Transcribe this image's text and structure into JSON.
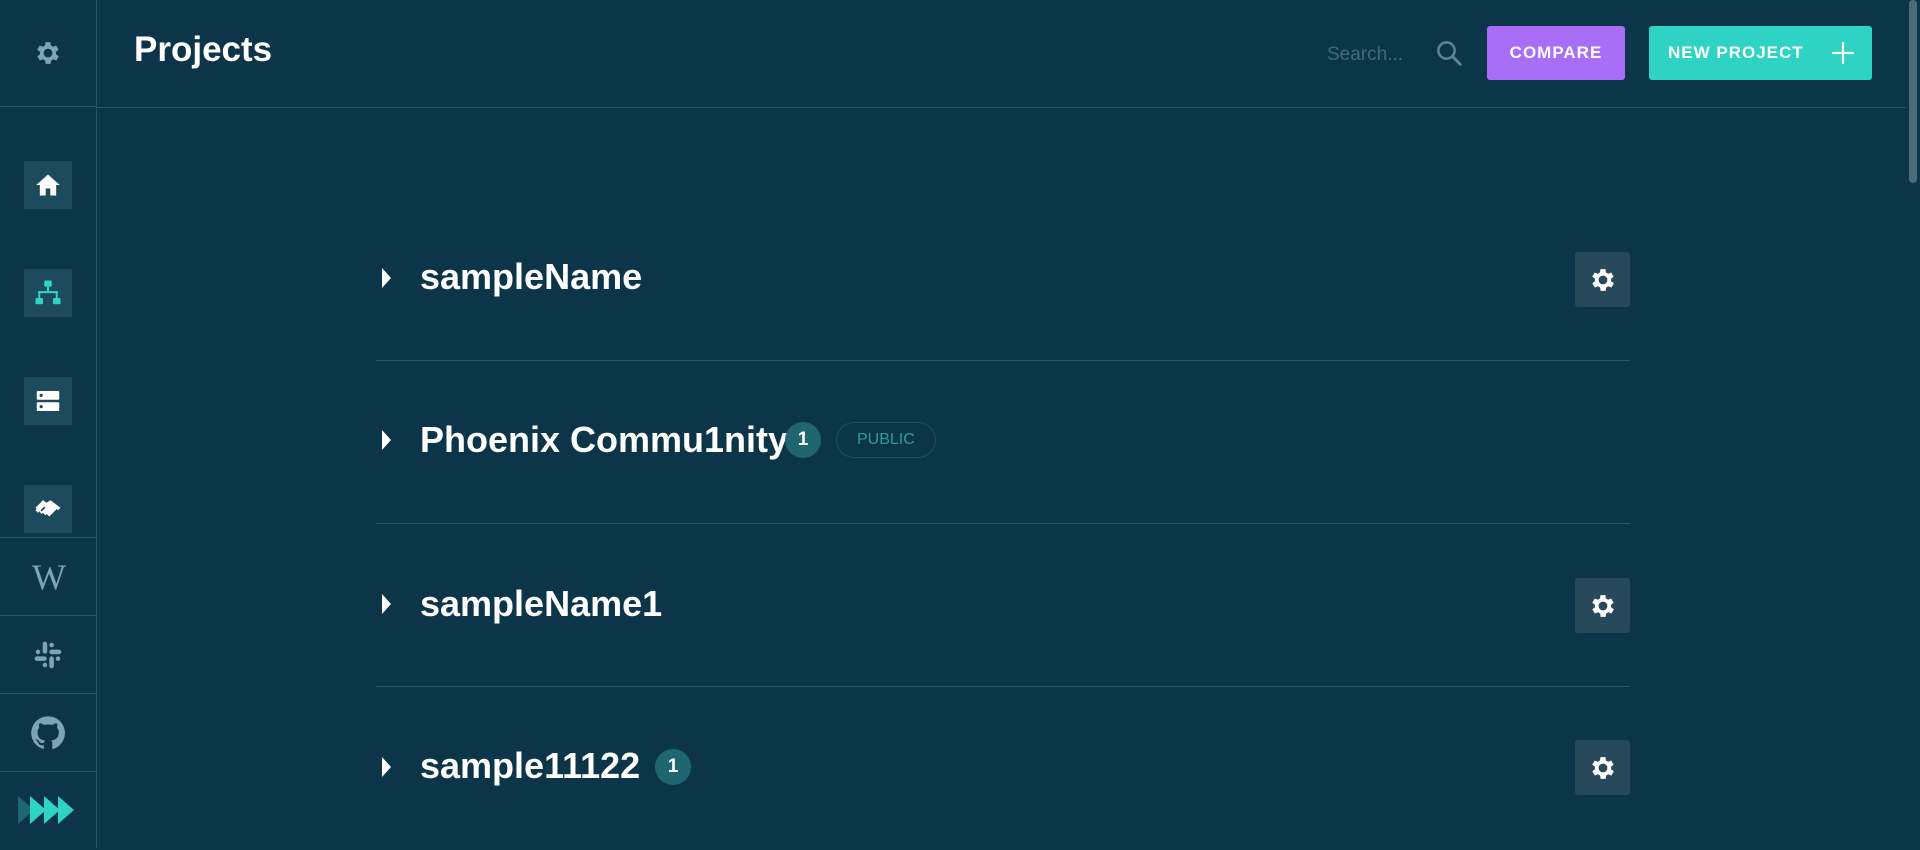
{
  "header": {
    "title": "Projects",
    "search_placeholder": "Search...",
    "compare_label": "COMPARE",
    "new_project_label": "NEW PROJECT"
  },
  "sidebar": {
    "nav_items": [
      {
        "name": "home",
        "icon": "home-icon"
      },
      {
        "name": "projects",
        "icon": "sitemap-icon"
      },
      {
        "name": "servers",
        "icon": "server-icon"
      },
      {
        "name": "partners",
        "icon": "handshake-icon"
      }
    ],
    "links": [
      {
        "name": "wiki",
        "icon": "wikipedia-icon",
        "glyph": "W"
      },
      {
        "name": "slack",
        "icon": "slack-icon"
      },
      {
        "name": "github",
        "icon": "github-icon"
      },
      {
        "name": "expand",
        "icon": "triple-chevron-icon"
      }
    ]
  },
  "projects": [
    {
      "name": "sampleName",
      "count": null,
      "visibility": null,
      "has_settings": true
    },
    {
      "name": "Phoenix Commu1nity",
      "count": "1",
      "visibility": "PUBLIC",
      "has_settings": false
    },
    {
      "name": "sampleName1",
      "count": null,
      "visibility": null,
      "has_settings": true
    },
    {
      "name": "sample11122",
      "count": "1",
      "visibility": null,
      "has_settings": true
    }
  ],
  "colors": {
    "background": "#0d3549",
    "compare": "#a96ef8",
    "new_project": "#2fd3c4",
    "accent_teal": "#2fd3c4",
    "count_badge": "#1f6670"
  }
}
